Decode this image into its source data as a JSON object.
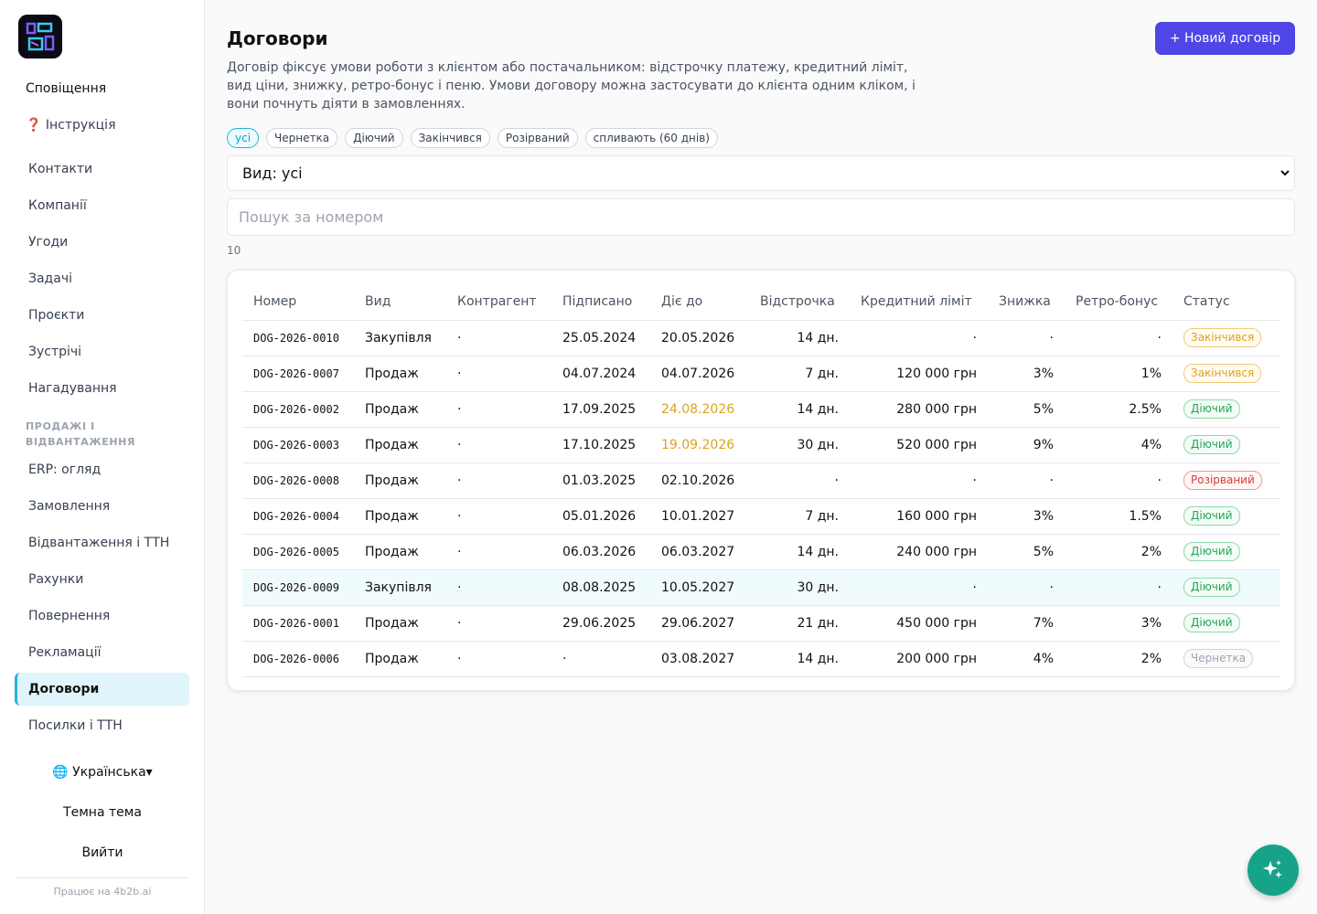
{
  "sidebar": {
    "notifications": "Сповіщення",
    "instructions": "❓ Інструкція",
    "items": [
      "Контакти",
      "Компанії",
      "Угоди",
      "Задачі",
      "Проєкти",
      "Зустрічі",
      "Нагадування"
    ],
    "section_label": "ПРОДАЖІ І ВІДВАНТАЖЕННЯ",
    "sales_items": [
      "ERP: огляд",
      "Замовлення",
      "Відвантаження і ТТН",
      "Рахунки",
      "Повернення",
      "Рекламації",
      "Договори",
      "Посилки і ТТН"
    ],
    "active_item": "Договори",
    "language": "🌐 Українська▾",
    "theme": "Темна тема",
    "logout": "Вийти",
    "powered_by": "Працює на 4b2b.ai"
  },
  "header": {
    "title": "Договори",
    "new_button": "+ Новий договір",
    "description": "Договір фіксує умови роботи з клієнтом або постачальником: відстрочку платежу, кредитний ліміт, вид ціни, знижку, ретро-бонус і пеню. Умови договору можна застосувати до клієнта одним кліком, і вони почнуть діяти в замовленнях."
  },
  "filters": {
    "chips": [
      "усі",
      "Чернетка",
      "Діючий",
      "Закінчився",
      "Розірваний",
      "спливають (60 днів)"
    ],
    "active_chip": "усі",
    "type_select": "Вид: усі",
    "search_placeholder": "Пошук за номером",
    "count": "10"
  },
  "table": {
    "columns": [
      "Номер",
      "Вид",
      "Контрагент",
      "Підписано",
      "Діє до",
      "Відстрочка",
      "Кредитний ліміт",
      "Знижка",
      "Ретро-бонус",
      "Статус"
    ],
    "rows": [
      {
        "number": "DOG-2026-0010",
        "type": "Закупівля",
        "counterparty": "·",
        "signed": "25.05.2024",
        "valid_until": "20.05.2026",
        "deferral": "14 дн.",
        "credit_limit": "·",
        "discount": "·",
        "retro_bonus": "·",
        "status": "Закінчився",
        "status_kind": "ended",
        "expiring": false,
        "highlighted": false
      },
      {
        "number": "DOG-2026-0007",
        "type": "Продаж",
        "counterparty": "·",
        "signed": "04.07.2024",
        "valid_until": "04.07.2026",
        "deferral": "7 дн.",
        "credit_limit": "120 000 грн",
        "discount": "3%",
        "retro_bonus": "1%",
        "status": "Закінчився",
        "status_kind": "ended",
        "expiring": false,
        "highlighted": false
      },
      {
        "number": "DOG-2026-0002",
        "type": "Продаж",
        "counterparty": "·",
        "signed": "17.09.2025",
        "valid_until": "24.08.2026",
        "deferral": "14 дн.",
        "credit_limit": "280 000 грн",
        "discount": "5%",
        "retro_bonus": "2.5%",
        "status": "Діючий",
        "status_kind": "active",
        "expiring": true,
        "highlighted": false
      },
      {
        "number": "DOG-2026-0003",
        "type": "Продаж",
        "counterparty": "·",
        "signed": "17.10.2025",
        "valid_until": "19.09.2026",
        "deferral": "30 дн.",
        "credit_limit": "520 000 грн",
        "discount": "9%",
        "retro_bonus": "4%",
        "status": "Діючий",
        "status_kind": "active",
        "expiring": true,
        "highlighted": false
      },
      {
        "number": "DOG-2026-0008",
        "type": "Продаж",
        "counterparty": "·",
        "signed": "01.03.2025",
        "valid_until": "02.10.2026",
        "deferral": "·",
        "credit_limit": "·",
        "discount": "·",
        "retro_bonus": "·",
        "status": "Розірваний",
        "status_kind": "term",
        "expiring": false,
        "highlighted": false
      },
      {
        "number": "DOG-2026-0004",
        "type": "Продаж",
        "counterparty": "·",
        "signed": "05.01.2026",
        "valid_until": "10.01.2027",
        "deferral": "7 дн.",
        "credit_limit": "160 000 грн",
        "discount": "3%",
        "retro_bonus": "1.5%",
        "status": "Діючий",
        "status_kind": "active",
        "expiring": false,
        "highlighted": false
      },
      {
        "number": "DOG-2026-0005",
        "type": "Продаж",
        "counterparty": "·",
        "signed": "06.03.2026",
        "valid_until": "06.03.2027",
        "deferral": "14 дн.",
        "credit_limit": "240 000 грн",
        "discount": "5%",
        "retro_bonus": "2%",
        "status": "Діючий",
        "status_kind": "active",
        "expiring": false,
        "highlighted": false
      },
      {
        "number": "DOG-2026-0009",
        "type": "Закупівля",
        "counterparty": "·",
        "signed": "08.08.2025",
        "valid_until": "10.05.2027",
        "deferral": "30 дн.",
        "credit_limit": "·",
        "discount": "·",
        "retro_bonus": "·",
        "status": "Діючий",
        "status_kind": "active",
        "expiring": false,
        "highlighted": true
      },
      {
        "number": "DOG-2026-0001",
        "type": "Продаж",
        "counterparty": "·",
        "signed": "29.06.2025",
        "valid_until": "29.06.2027",
        "deferral": "21 дн.",
        "credit_limit": "450 000 грн",
        "discount": "7%",
        "retro_bonus": "3%",
        "status": "Діючий",
        "status_kind": "active",
        "expiring": false,
        "highlighted": false
      },
      {
        "number": "DOG-2026-0006",
        "type": "Продаж",
        "counterparty": "·",
        "signed": "·",
        "valid_until": "03.08.2027",
        "deferral": "14 дн.",
        "credit_limit": "200 000 грн",
        "discount": "4%",
        "retro_bonus": "2%",
        "status": "Чернетка",
        "status_kind": "draft",
        "expiring": false,
        "highlighted": false
      }
    ]
  },
  "colors": {
    "accent": "#4f46e5",
    "active_nav": "#dff4fb",
    "expiring_date": "#e0a020",
    "status_active": "#22a55a",
    "status_ended": "#e0a020",
    "status_terminated": "#dc3b3b",
    "status_draft": "#9ca3af",
    "fab": "#17a389"
  },
  "icons": {
    "fab": "sparkle-icon",
    "select": "chevron-down-icon"
  }
}
